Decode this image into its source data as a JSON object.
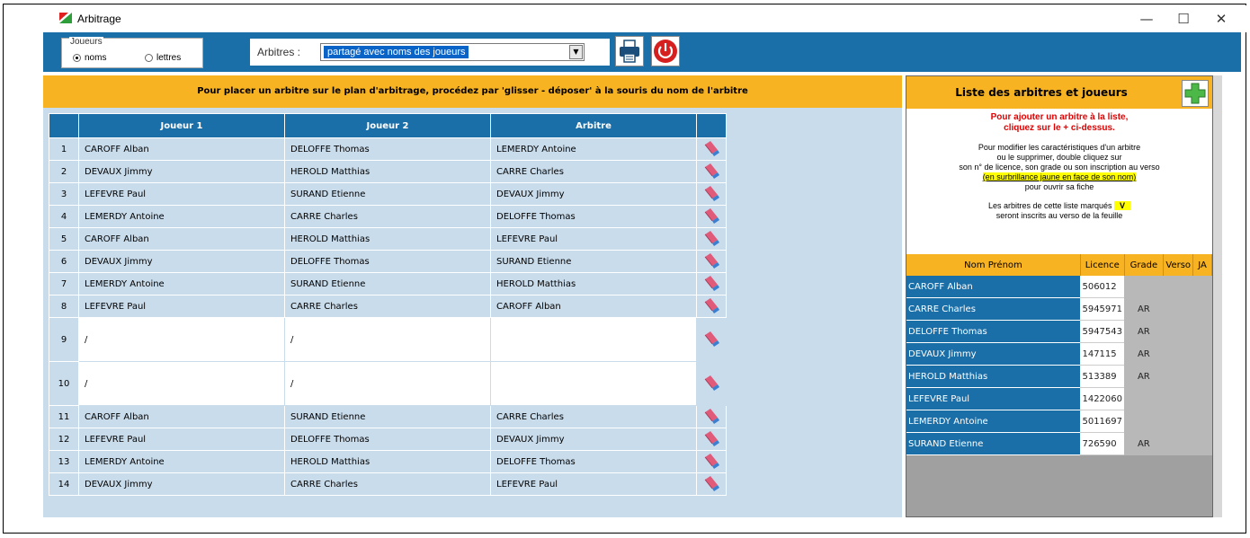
{
  "window": {
    "title": "Arbitrage",
    "minimize": "—",
    "maximize": "☐",
    "close": "✕"
  },
  "toolbar": {
    "players_group_title": "Joueurs",
    "radio_names": "noms",
    "radio_letters": "lettres",
    "arbitres_label": "Arbitres :",
    "arbitres_selected": "partagé avec noms des joueurs"
  },
  "instruction": "Pour placer un arbitre sur le plan d'arbitrage, procédez par 'glisser - déposer'  à la souris du nom de l'arbitre",
  "grid": {
    "columns": [
      "Joueur 1",
      "Joueur 2",
      "Arbitre"
    ],
    "rows": [
      {
        "n": "1",
        "j1": "CAROFF Alban",
        "j2": "DELOFFE Thomas",
        "arb": "LEMERDY Antoine"
      },
      {
        "n": "2",
        "j1": "DEVAUX Jimmy",
        "j2": "HEROLD Matthias",
        "arb": "CARRE Charles"
      },
      {
        "n": "3",
        "j1": "LEFEVRE Paul",
        "j2": "SURAND Etienne",
        "arb": "DEVAUX Jimmy"
      },
      {
        "n": "4",
        "j1": "LEMERDY Antoine",
        "j2": "CARRE Charles",
        "arb": "DELOFFE Thomas"
      },
      {
        "n": "5",
        "j1": "CAROFF Alban",
        "j2": "HEROLD Matthias",
        "arb": "LEFEVRE Paul"
      },
      {
        "n": "6",
        "j1": "DEVAUX Jimmy",
        "j2": "DELOFFE Thomas",
        "arb": "SURAND Etienne"
      },
      {
        "n": "7",
        "j1": "LEMERDY Antoine",
        "j2": "SURAND Etienne",
        "arb": "HEROLD Matthias"
      },
      {
        "n": "8",
        "j1": "LEFEVRE Paul",
        "j2": "CARRE Charles",
        "arb": "CAROFF Alban"
      },
      {
        "n": "9",
        "j1": "/",
        "j2": "/",
        "arb": "",
        "blank": true
      },
      {
        "n": "10",
        "j1": "/",
        "j2": "/",
        "arb": "",
        "blank": true
      },
      {
        "n": "11",
        "j1": "CAROFF Alban",
        "j2": "SURAND Etienne",
        "arb": "CARRE Charles"
      },
      {
        "n": "12",
        "j1": "LEFEVRE Paul",
        "j2": "DELOFFE Thomas",
        "arb": "DEVAUX Jimmy"
      },
      {
        "n": "13",
        "j1": "LEMERDY Antoine",
        "j2": "HEROLD Matthias",
        "arb": "DELOFFE Thomas"
      },
      {
        "n": "14",
        "j1": "DEVAUX Jimmy",
        "j2": "CARRE Charles",
        "arb": "LEFEVRE Paul"
      }
    ]
  },
  "right": {
    "title": "Liste des arbitres et joueurs",
    "red_line1": "Pour ajouter un arbitre à la liste,",
    "red_line2": "cliquez sur le + ci-dessus.",
    "info_line1": "Pour modifier les caractéristiques d'un arbitre",
    "info_line2": "ou le supprimer, double cliquez sur",
    "info_line3": "son n° de licence, son grade ou son inscription au verso",
    "info_highlight": "(en surbrillance jaune en face de son nom)",
    "info_line4": "pour ouvrir sa fiche",
    "marked_line1": "Les arbitres de cette liste marqués",
    "marked_badge": "V",
    "marked_line2": "seront inscrits au verso de la feuille",
    "columns": [
      "Nom Prénom",
      "Licence",
      "Grade",
      "Verso",
      "JA"
    ],
    "rows": [
      {
        "name": "CAROFF  Alban",
        "licence": "506012",
        "grade": ""
      },
      {
        "name": "CARRE  Charles",
        "licence": "5945971",
        "grade": "AR"
      },
      {
        "name": "DELOFFE  Thomas",
        "licence": "5947543",
        "grade": "AR"
      },
      {
        "name": "DEVAUX  Jimmy",
        "licence": "147115",
        "grade": "AR"
      },
      {
        "name": "HEROLD  Matthias",
        "licence": "513389",
        "grade": "AR"
      },
      {
        "name": "LEFEVRE  Paul",
        "licence": "1422060",
        "grade": ""
      },
      {
        "name": "LEMERDY  Antoine",
        "licence": "5011697",
        "grade": ""
      },
      {
        "name": "SURAND  Etienne",
        "licence": "726590",
        "grade": "AR"
      }
    ]
  },
  "colors": {
    "toolbar_blue": "#1b6fa8",
    "header_orange": "#f8b323",
    "grid_bg": "#c9dcec"
  }
}
